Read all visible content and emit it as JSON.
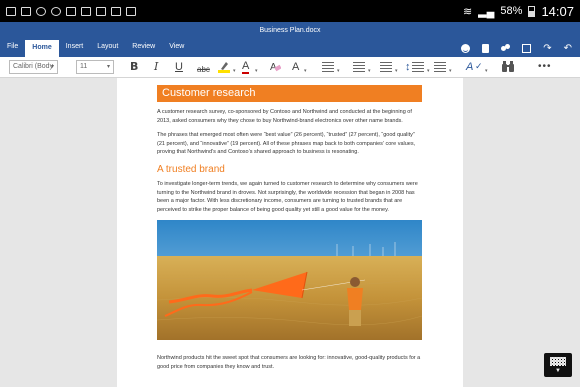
{
  "status_bar": {
    "battery": "58%",
    "time": "14:07"
  },
  "window": {
    "title": "Business Plan.docx"
  },
  "tabs": [
    {
      "label": "File"
    },
    {
      "label": "Home"
    },
    {
      "label": "Insert"
    },
    {
      "label": "Layout"
    },
    {
      "label": "Review"
    },
    {
      "label": "View"
    }
  ],
  "toolbar": {
    "font_name": "Calibri (Body",
    "font_size": "11",
    "bold": "B",
    "italic": "I",
    "underline": "U",
    "strikethrough": "abc",
    "font_color": "A",
    "font_size_grow": "A",
    "style": "A",
    "more": "•••"
  },
  "document": {
    "heading1": "Customer research",
    "para1": "A customer research survey, co-sponsored by Contoso and Northwind and conducted at the beginning of 2013, asked consumers why they chose to buy Northwind-brand electronics over other name brands.",
    "para2": "The phrases that emerged most often were “best value” (26 percent), “trusted” (27 percent), “good quality” (21 percent), and “innovative” (19 percent). All of these phrases map back to both companies’ core values, proving that Northwind’s and Contoso’s shared approach to business is resonating.",
    "heading2": "A trusted brand",
    "para3": "To investigate longer-term trends, we again turned to customer research to determine why consumers were turning to the Northwind brand in droves. Not surprisingly, the worldwide recession that began in 2008 has been a major factor. With less discretionary income, consumers are turning to trusted brands that are perceived to strike the proper balance of being good quality yet still a good value for the money.",
    "para4": "Northwind products hit the sweet spot that consumers are looking for: innovative, good-quality products for a good price from companies they know and trust."
  },
  "colors": {
    "brand_blue": "#2b579a",
    "heading_orange": "#f07f22"
  },
  "icons": [
    "smiley-icon",
    "save-icon",
    "share-icon",
    "layout-icon",
    "redo-icon",
    "undo-icon",
    "highlighter-icon",
    "bullets-icon",
    "numbering-icon",
    "align-icon",
    "line-spacing-icon",
    "paragraph-icon",
    "spellcheck-icon",
    "find-icon",
    "keyboard-icon"
  ]
}
